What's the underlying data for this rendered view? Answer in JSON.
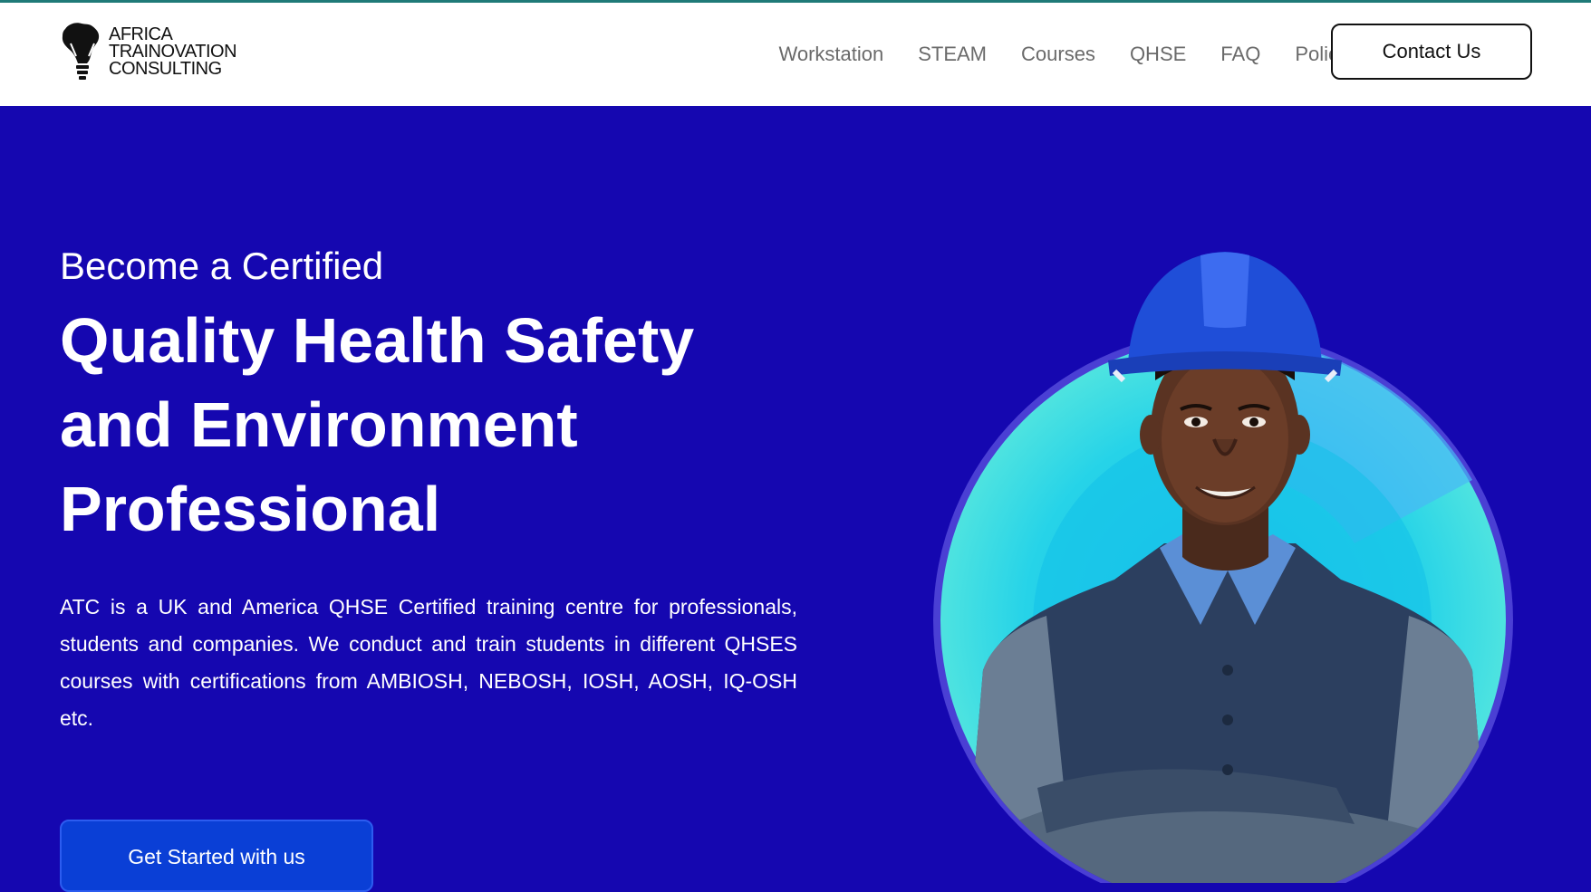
{
  "brand": {
    "line1": "AFRICA",
    "line2": "TRAINOVATION",
    "line3": "CONSULTING"
  },
  "nav": {
    "items": [
      "Workstation",
      "STEAM",
      "Courses",
      "QHSE",
      "FAQ",
      "Policy"
    ],
    "contact_label": "Contact Us"
  },
  "hero": {
    "pre_title": "Become a Certified",
    "title_line1": "Quality Health Safety",
    "title_line2": "and Environment",
    "title_line3": "Professional",
    "description": "ATC is a UK and America QHSE Certified training centre for professionals, students and companies. We conduct and train students in different QHSES courses with certifications from AMBIOSH, NEBOSH, IOSH, AOSH, IQ-OSH etc.",
    "cta_label": "Get Started with us"
  },
  "colors": {
    "hero_background": "#1507b0",
    "cta_background": "#0a3fd6",
    "nav_text": "#6a6a6a",
    "accent_circle": "#3fe0e0"
  },
  "icons": [
    "africa-lightbulb-logo-icon"
  ]
}
